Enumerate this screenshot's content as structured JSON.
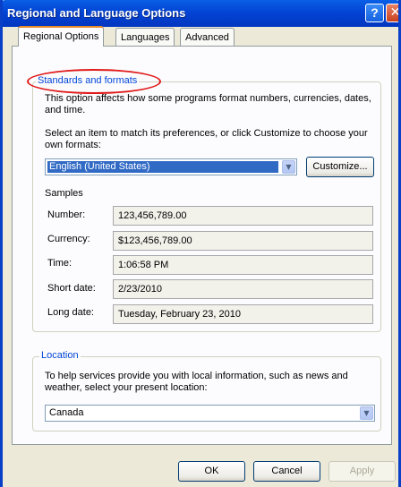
{
  "window": {
    "title": "Regional and Language Options",
    "help_glyph": "?",
    "close_glyph": "✕"
  },
  "tabs": [
    {
      "label": "Regional Options",
      "active": true
    },
    {
      "label": "Languages",
      "active": false
    },
    {
      "label": "Advanced",
      "active": false
    }
  ],
  "standards": {
    "legend": "Standards and formats",
    "description": "This option affects how some programs format numbers, currencies, dates, and time.",
    "instruction": "Select an item to match its preferences, or click Customize to choose your own formats:",
    "format_value": "English (United States)",
    "customize_label": "Customize...",
    "samples_heading": "Samples",
    "samples": [
      {
        "label": "Number:",
        "value": "123,456,789.00"
      },
      {
        "label": "Currency:",
        "value": "$123,456,789.00"
      },
      {
        "label": "Time:",
        "value": "1:06:58 PM"
      },
      {
        "label": "Short date:",
        "value": "2/23/2010"
      },
      {
        "label": "Long date:",
        "value": "Tuesday, February 23, 2010"
      }
    ]
  },
  "location": {
    "legend": "Location",
    "description": "To help services provide you with local information, such as news and weather, select your present location:",
    "value": "Canada"
  },
  "footer": {
    "ok_label": "OK",
    "cancel_label": "Cancel",
    "apply_label": "Apply"
  },
  "annotation": {
    "color": "#e01919"
  },
  "colors": {
    "title_bar": "#0344d4",
    "legend_text": "#0046d5",
    "selection": "#316ac5",
    "tab_highlight": "#e68b2c"
  }
}
